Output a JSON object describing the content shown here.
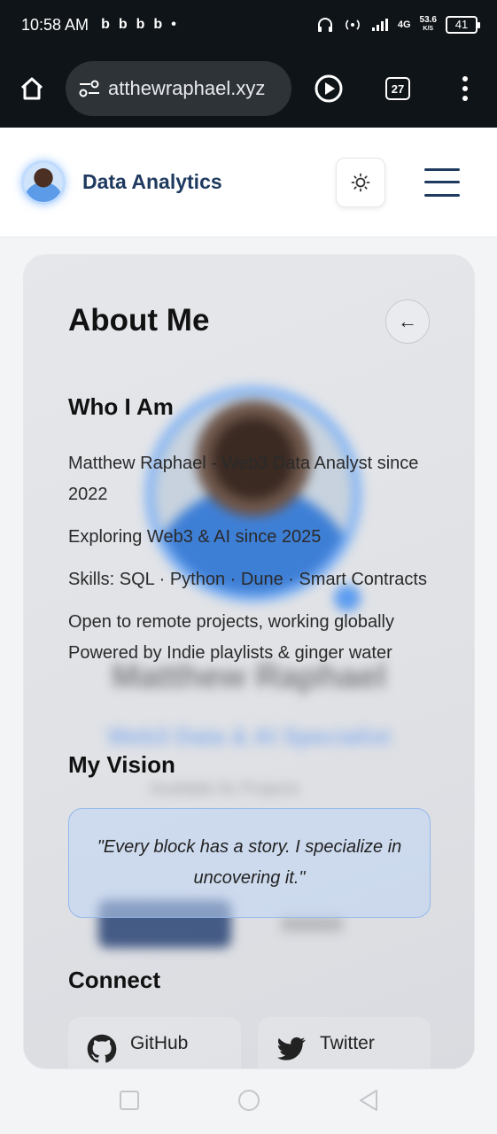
{
  "status_bar": {
    "time": "10:58 AM",
    "notification_icons": [
      "b",
      "b",
      "b",
      "b",
      "•"
    ],
    "network_type": "4G",
    "speed_value": "53.6",
    "speed_unit": "K/S",
    "battery": "41"
  },
  "browser": {
    "url": "atthewraphael.xyz",
    "tab_count": "27"
  },
  "site_header": {
    "brand": "Data Analytics"
  },
  "about": {
    "title": "About Me",
    "back_symbol": "←",
    "who_heading": "Who I Am",
    "lines": [
      "Matthew Raphael - Web3 Data Analyst since 2022",
      "Exploring Web3 & AI since 2025",
      "Skills: SQL · Python · Dune · Smart Contracts",
      "Open to remote projects, working globally",
      "Powered by Indie playlists & ginger water"
    ],
    "vision_heading": "My Vision",
    "quote": "\"Every block has a story. I specialize in uncovering it.\"",
    "connect_heading": "Connect",
    "social": [
      {
        "label": "GitHub",
        "icon": "github-icon"
      },
      {
        "label": "Twitter",
        "icon": "twitter-icon"
      }
    ]
  },
  "background_profile": {
    "name": "Matthew Raphael",
    "role": "Web3 Data & AI Specialist",
    "availability": "Available for Projects"
  },
  "colors": {
    "brand": "#1e3a5f",
    "accent_blue": "#60a5fa",
    "browser_chrome": "#0f1418"
  }
}
